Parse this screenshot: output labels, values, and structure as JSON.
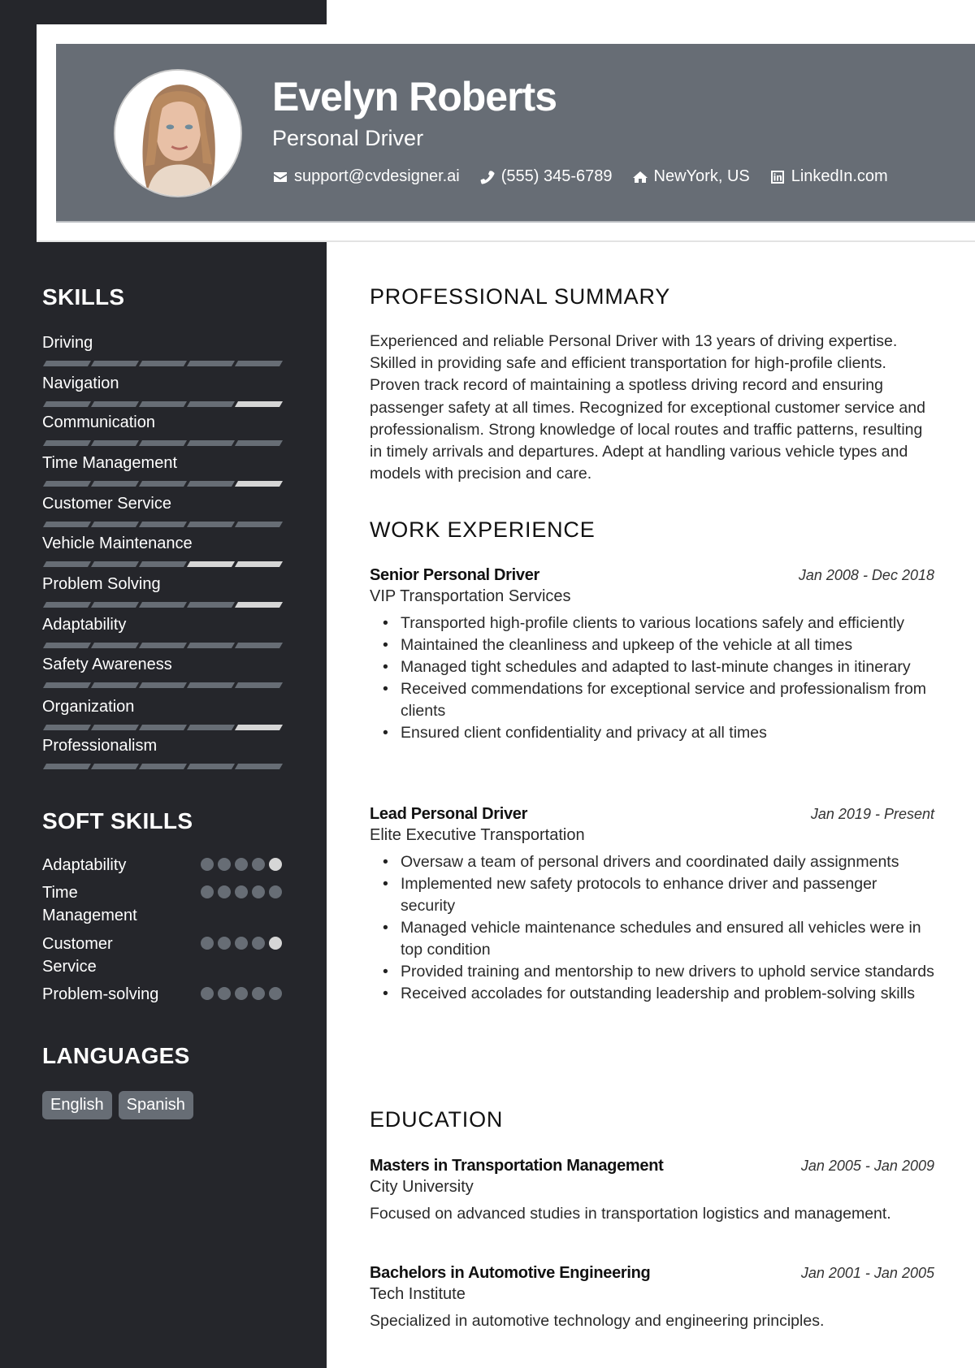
{
  "profile": {
    "name": "Evelyn Roberts",
    "title": "Personal Driver",
    "contacts": [
      {
        "icon": "envelope-icon",
        "text": "support@cvdesigner.ai"
      },
      {
        "icon": "phone-icon",
        "text": "(555) 345-6789"
      },
      {
        "icon": "home-icon",
        "text": "NewYork, US"
      },
      {
        "icon": "linkedin-icon",
        "text": "LinkedIn.com"
      }
    ]
  },
  "colors": {
    "sidebar_bg": "#25262b",
    "header_bg": "#676d75",
    "rating_on": "#d6d6d6",
    "rating_off": "#676d75"
  },
  "sidebar": {
    "skills_heading": "SKILLS",
    "skills": [
      {
        "name": "Driving",
        "lit_segments": [],
        "scale": 5
      },
      {
        "name": "Navigation",
        "lit_segments": [
          5
        ],
        "scale": 5
      },
      {
        "name": "Communication",
        "lit_segments": [],
        "scale": 5
      },
      {
        "name": "Time Management",
        "lit_segments": [
          5
        ],
        "scale": 5
      },
      {
        "name": "Customer Service",
        "lit_segments": [],
        "scale": 5
      },
      {
        "name": "Vehicle Maintenance",
        "lit_segments": [
          4,
          5
        ],
        "scale": 5
      },
      {
        "name": "Problem Solving",
        "lit_segments": [
          5
        ],
        "scale": 5
      },
      {
        "name": "Adaptability",
        "lit_segments": [],
        "scale": 5
      },
      {
        "name": "Safety Awareness",
        "lit_segments": [],
        "scale": 5
      },
      {
        "name": "Organization",
        "lit_segments": [
          5
        ],
        "scale": 5
      },
      {
        "name": "Professionalism",
        "lit_segments": [],
        "scale": 5
      }
    ],
    "soft_skills_heading": "SOFT SKILLS",
    "soft_skills": [
      {
        "name": "Adaptability",
        "lit_dots": [
          5
        ],
        "scale": 5
      },
      {
        "name": "Time Management",
        "lit_dots": [],
        "scale": 5
      },
      {
        "name": "Customer Service",
        "lit_dots": [
          5
        ],
        "scale": 5
      },
      {
        "name": "Problem-solving",
        "lit_dots": [],
        "scale": 5
      }
    ],
    "languages_heading": "LANGUAGES",
    "languages": [
      "English",
      "Spanish"
    ]
  },
  "main": {
    "summary_heading": "PROFESSIONAL SUMMARY",
    "summary": "Experienced and reliable Personal Driver with 13 years of driving expertise. Skilled in providing safe and efficient transportation for high-profile clients. Proven track record of maintaining a spotless driving record and ensuring passenger safety at all times. Recognized for exceptional customer service and professionalism. Strong knowledge of local routes and traffic patterns, resulting in timely arrivals and departures. Adept at handling various vehicle types and models with precision and care.",
    "experience_heading": "WORK EXPERIENCE",
    "experience": [
      {
        "title": "Senior Personal Driver",
        "dates": "Jan 2008 - Dec 2018",
        "company": "VIP Transportation Services",
        "bullets": [
          "Transported high-profile clients to various locations safely and efficiently",
          "Maintained the cleanliness and upkeep of the vehicle at all times",
          "Managed tight schedules and adapted to last-minute changes in itinerary",
          "Received commendations for exceptional service and professionalism from clients",
          "Ensured client confidentiality and privacy at all times"
        ]
      },
      {
        "title": "Lead Personal Driver",
        "dates": "Jan 2019 - Present",
        "company": "Elite Executive Transportation",
        "bullets": [
          "Oversaw a team of personal drivers and coordinated daily assignments",
          "Implemented new safety protocols to enhance driver and passenger security",
          "Managed vehicle maintenance schedules and ensured all vehicles were in top condition",
          "Provided training and mentorship to new drivers to uphold service standards",
          "Received accolades for outstanding leadership and problem-solving skills"
        ]
      }
    ],
    "education_heading": "EDUCATION",
    "education": [
      {
        "degree": "Masters in Transportation Management",
        "dates": "Jan 2005 - Jan 2009",
        "school": "City University",
        "description": "Focused on advanced studies in transportation logistics and management."
      },
      {
        "degree": "Bachelors in Automotive Engineering",
        "dates": "Jan 2001 - Jan 2005",
        "school": "Tech Institute",
        "description": "Specialized in automotive technology and engineering principles."
      }
    ]
  }
}
